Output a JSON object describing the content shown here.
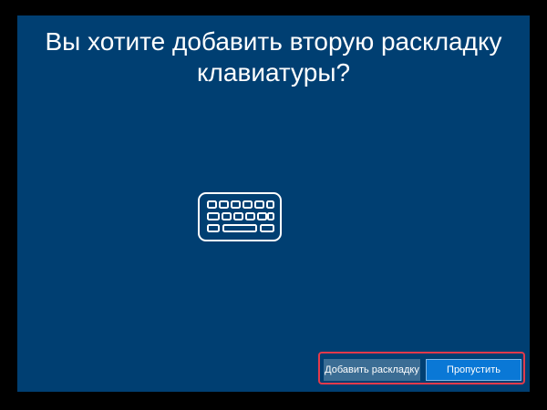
{
  "dialog": {
    "title_line1": "Вы хотите добавить вторую раскладку",
    "title_line2": "клавиатуры?",
    "icon": "keyboard-icon"
  },
  "actions": {
    "add_label": "Добавить раскладку",
    "skip_label": "Пропустить"
  },
  "colors": {
    "background": "#003f72",
    "frame": "#000000",
    "add_button": "#3b6d94",
    "skip_button": "#0a78d6",
    "highlight": "#e23a4b"
  }
}
